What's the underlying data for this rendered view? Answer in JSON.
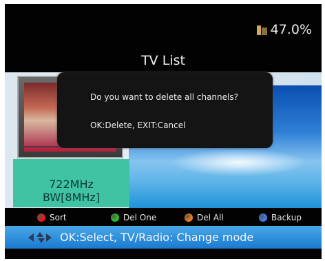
{
  "header": {
    "storage_value": "47.0%",
    "title": "TV List"
  },
  "preview": {
    "frequency": "722MHz",
    "bandwidth": "BW[8MHz]"
  },
  "dialog": {
    "question": "Do you want to delete all channels?",
    "help": "OK:Delete, EXIT:Cancel"
  },
  "legend": [
    {
      "label": "Sort",
      "color": "#e81818"
    },
    {
      "label": "Del One",
      "color": "#22c422"
    },
    {
      "label": "Del All",
      "color": "#f07a18"
    },
    {
      "label": "Backup",
      "color": "#3a7ef0"
    }
  ],
  "hint_bar": {
    "text": "OK:Select, TV/Radio: Change mode"
  },
  "colors": {
    "accent_blue": "#1a7ad0",
    "freq_panel": "#3fc3a3"
  }
}
